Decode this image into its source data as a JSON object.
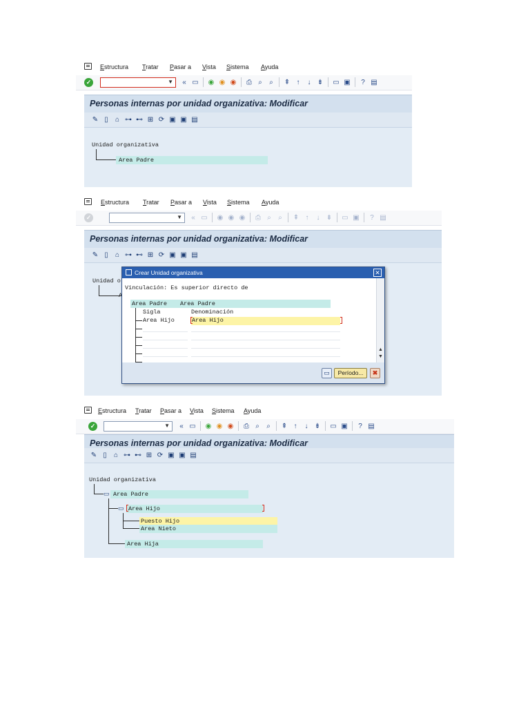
{
  "menu": {
    "estructura": "Estructura",
    "tratar": "Tratar",
    "pasar_a": "Pasar a",
    "vista": "Vista",
    "sistema": "Sistema",
    "ayuda": "Ayuda"
  },
  "title": "Personas internas por unidad organizativa: Modificar",
  "toolbar": {
    "back_label": "«",
    "dropdown_arrow": "▼",
    "icons": [
      "save-icon",
      "back-icon",
      "exit-icon",
      "cancel-icon",
      "print-icon",
      "find-icon",
      "find-next-icon",
      "first-page-icon",
      "prev-page-icon",
      "next-page-icon",
      "last-page-icon",
      "new-session-icon",
      "shortcut-icon",
      "help-icon",
      "layout-icon"
    ]
  },
  "screen1": {
    "root": "Unidad organizativa",
    "child": "Area Padre"
  },
  "screen2": {
    "root_partial": "Unidad o",
    "child_partial": "A",
    "dialog": {
      "title": "Crear Unidad organizativa",
      "vinculacion": "Vinculación: Es superior directo de",
      "parent_sigla": "Area Padre",
      "parent_denominacion": "Area Padre",
      "col_sigla": "Sigla",
      "col_denominacion": "Denominación",
      "row_sigla": "Area Hijo",
      "row_denominacion": "Area Hijo",
      "periodo_button": "Período...",
      "cancel_symbol": "✖"
    }
  },
  "screen3": {
    "root": "Unidad organizativa",
    "area_padre": "Area Padre",
    "area_hijo": "Area Hijo",
    "puesto_hijo": "Puesto Hijo",
    "area_nieto": "Area Nieto",
    "area_hija": "Area Hija"
  },
  "colors": {
    "title_bg": "#d3e0ee",
    "work_bg": "#e3ecf5",
    "highlight": "#c4ebe8",
    "highlight_yellow": "#fdf4a6",
    "dialog_title": "#2a5fb0"
  }
}
